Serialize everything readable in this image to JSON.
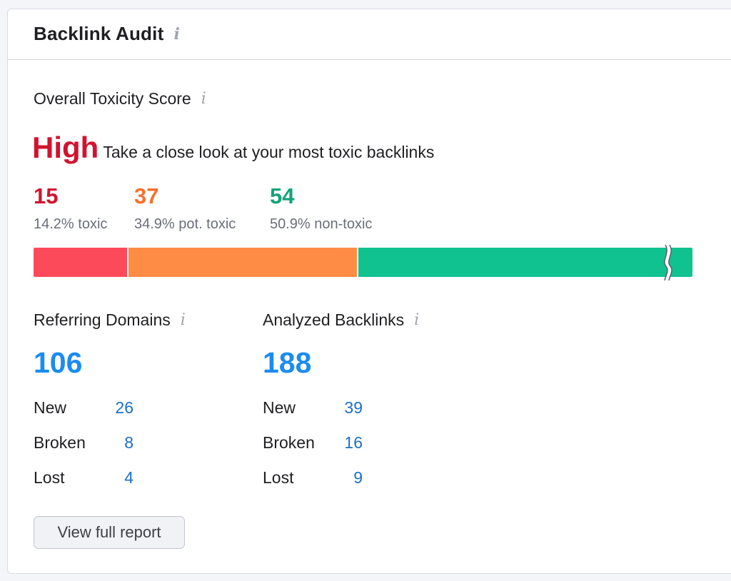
{
  "widget": {
    "title": "Backlink Audit",
    "info_icon": "info-icon"
  },
  "toxicity": {
    "label": "Overall Toxicity Score",
    "level": "High",
    "level_color": "#d1132f",
    "description": "Take a close look at your most toxic backlinks",
    "stats": [
      {
        "value": "15",
        "caption": "14.2% toxic",
        "color": "#d1132f"
      },
      {
        "value": "37",
        "caption": "34.9% pot. toxic",
        "color": "#f5702a"
      },
      {
        "value": "54",
        "caption": "50.9% non-toxic",
        "color": "#12a37a"
      }
    ],
    "bar": [
      {
        "name": "toxic",
        "percent": 14.2,
        "color": "#fd4a5a"
      },
      {
        "name": "pot-toxic",
        "percent": 34.9,
        "color": "#ff8c45"
      },
      {
        "name": "non-toxic",
        "percent": 50.9,
        "color": "#10c290"
      }
    ],
    "bar_truncated": true
  },
  "referring_domains": {
    "label": "Referring Domains",
    "total": "106",
    "rows": [
      {
        "label": "New",
        "value": "26"
      },
      {
        "label": "Broken",
        "value": "8"
      },
      {
        "label": "Lost",
        "value": "4"
      }
    ]
  },
  "analyzed_backlinks": {
    "label": "Analyzed Backlinks",
    "total": "188",
    "rows": [
      {
        "label": "New",
        "value": "39"
      },
      {
        "label": "Broken",
        "value": "16"
      },
      {
        "label": "Lost",
        "value": "9"
      }
    ]
  },
  "actions": {
    "view_report_label": "View full report"
  }
}
